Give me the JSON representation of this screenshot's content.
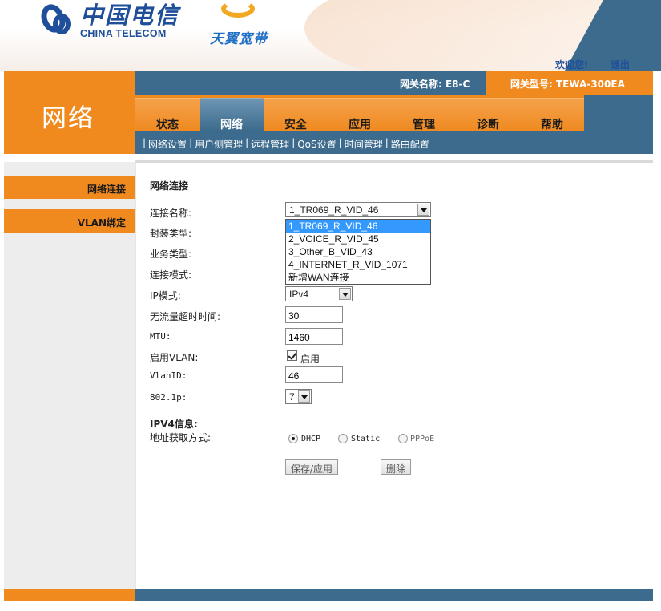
{
  "brand": {
    "logo_cn": "中国电信",
    "logo_en": "CHINA TELECOM",
    "sub_brand": "天翼宽带"
  },
  "header": {
    "welcome": "欢迎您!",
    "logout": "退出",
    "gateway_name_label": "网关名称: E8-C",
    "gateway_model_label": "网关型号: TEWA-300EA"
  },
  "page_title": "网络",
  "nav": {
    "tabs": [
      "状态",
      "网络",
      "安全",
      "应用",
      "管理",
      "诊断",
      "帮助"
    ],
    "active": "网络"
  },
  "sub_nav": {
    "items": [
      "网络设置",
      "用户侧管理",
      "远程管理",
      "QoS设置",
      "时间管理",
      "路由配置"
    ]
  },
  "sidebar": {
    "items": [
      "网络连接",
      "VLAN绑定"
    ]
  },
  "form": {
    "section_title": "网络连接",
    "labels": {
      "conn_name": "连接名称:",
      "encap_type": "封装类型:",
      "service_type": "业务类型:",
      "conn_mode": "连接模式:",
      "ip_mode": "IP模式:",
      "idle_timeout": "无流量超时时间:",
      "mtu": "MTU:",
      "enable_vlan": "启用VLAN:",
      "vlan_id": "VlanID:",
      "dot1p": "802.1p:"
    },
    "conn_name_value": "1_TR069_R_VID_46",
    "conn_name_options": [
      "1_TR069_R_VID_46",
      "2_VOICE_R_VID_45",
      "3_Other_B_VID_43",
      "4_INTERNET_R_VID_1071",
      "新增WAN连接"
    ],
    "ip_mode_value": "IPv4",
    "idle_timeout_value": "30",
    "mtu_value": "1460",
    "enable_vlan_checked": true,
    "enable_vlan_text": "启用",
    "vlan_id_value": "46",
    "dot1p_value": "7",
    "ipv4_section_title": "IPV4信息:",
    "addr_mode_label": "地址获取方式:",
    "addr_mode_options": [
      "DHCP",
      "Static",
      "PPPoE"
    ],
    "addr_mode_selected": "DHCP",
    "save_button": "保存/应用",
    "delete_button": "删除"
  },
  "colors": {
    "orange": "#f08a1f",
    "blue": "#3c6b8d",
    "brand_blue": "#1f4f9a",
    "select_highlight": "#3399ff"
  }
}
